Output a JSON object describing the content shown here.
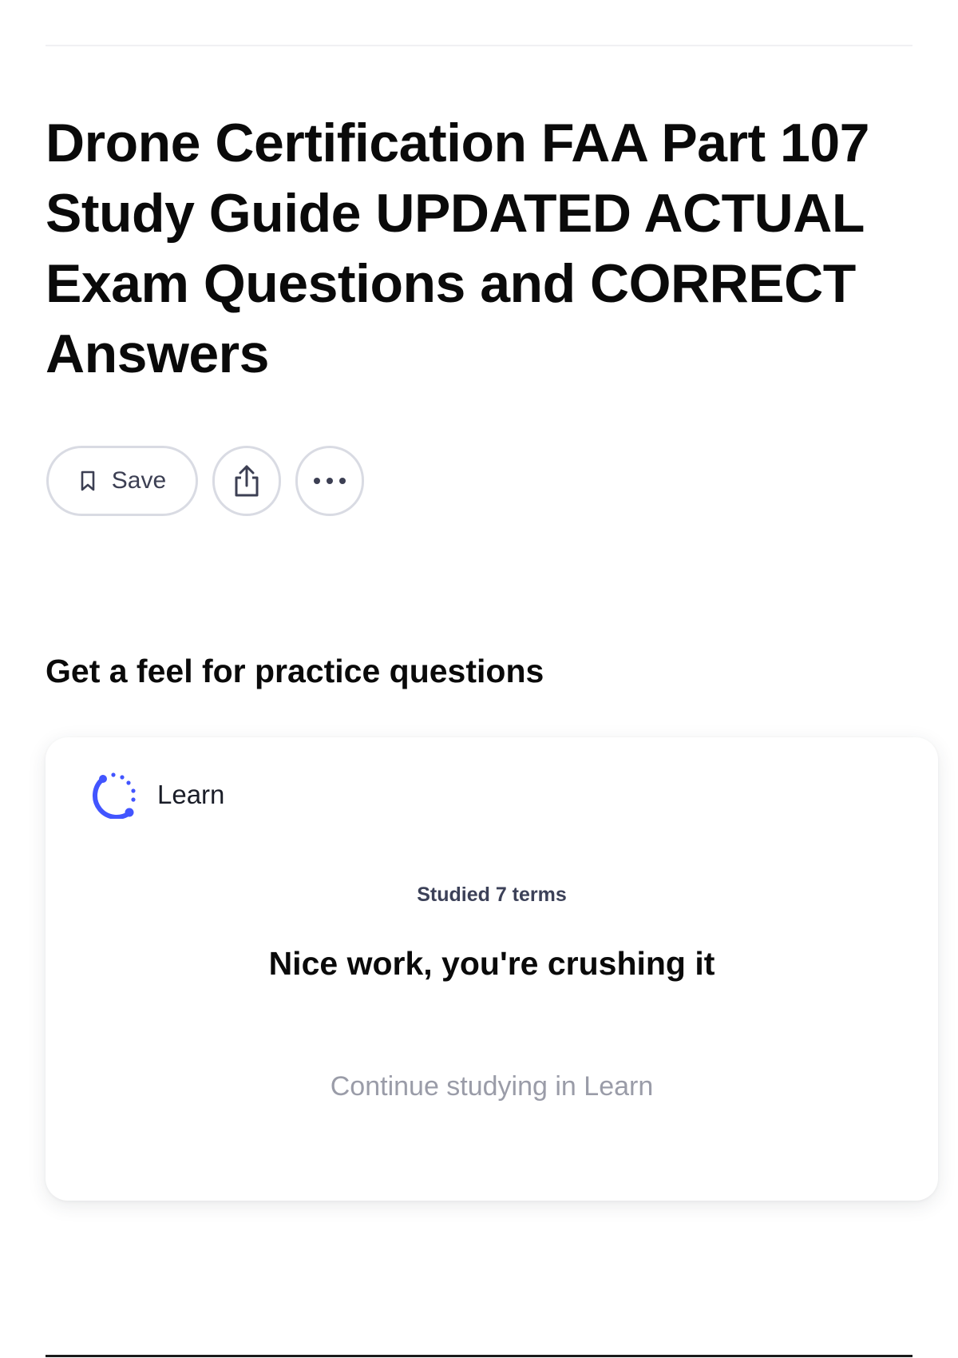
{
  "page": {
    "title": "Drone Certification FAA Part 107 Study Guide UPDATED ACTUAL Exam Questions and CORRECT Answers"
  },
  "actions": {
    "save_label": "Save",
    "save_icon": "bookmark-icon",
    "share_icon": "share-icon",
    "more_icon": "more-options-icon"
  },
  "practice": {
    "heading": "Get a feel for practice questions",
    "card": {
      "mode_label": "Learn",
      "mode_icon": "learn-progress-icon",
      "studied_text": "Studied 7 terms",
      "message": "Nice work, you're crushing it",
      "continue_label": "Continue studying in Learn"
    }
  },
  "colors": {
    "accent": "#4255ff",
    "text_primary": "#0a0a0a",
    "text_muted": "#9a9ca8",
    "border": "#d9dbe3"
  }
}
